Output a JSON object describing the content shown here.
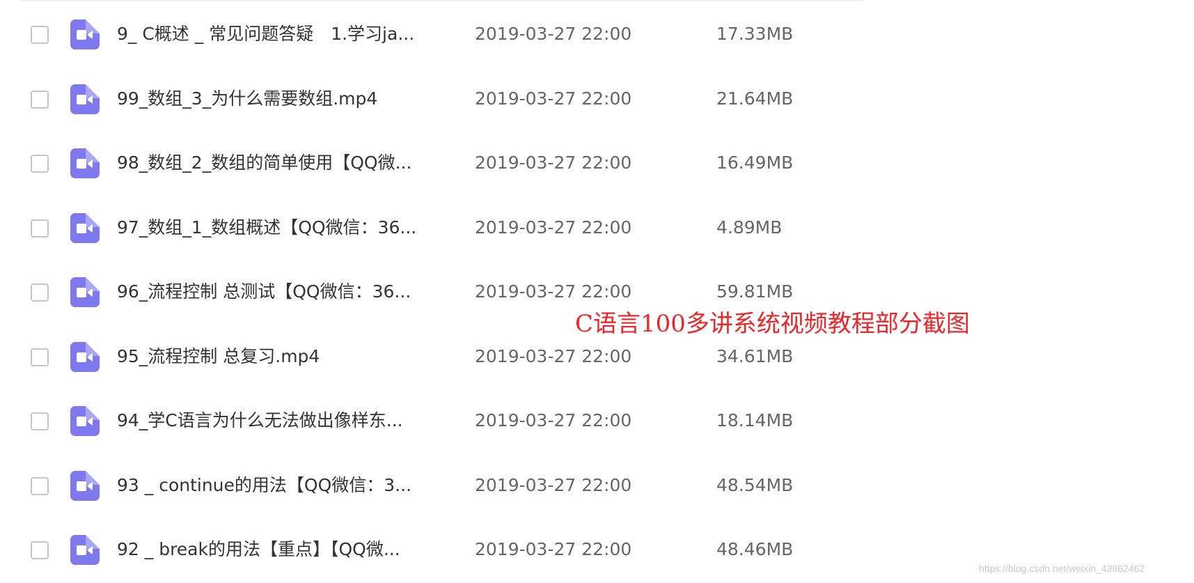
{
  "files": [
    {
      "name": "9_ C概述 _ 常见问题答疑　1.学习ja...",
      "date": "2019-03-27 22:00",
      "size": "17.33MB",
      "icon": "video-file-icon"
    },
    {
      "name": "99_数组_3_为什么需要数组.mp4",
      "date": "2019-03-27 22:00",
      "size": "21.64MB",
      "icon": "video-file-icon"
    },
    {
      "name": "98_数组_2_数组的简单使用【QQ微...",
      "date": "2019-03-27 22:00",
      "size": "16.49MB",
      "icon": "video-file-icon"
    },
    {
      "name": "97_数组_1_数组概述【QQ微信：36...",
      "date": "2019-03-27 22:00",
      "size": "4.89MB",
      "icon": "video-file-icon"
    },
    {
      "name": "96_流程控制 总测试【QQ微信：36...",
      "date": "2019-03-27 22:00",
      "size": "59.81MB",
      "icon": "video-file-icon"
    },
    {
      "name": "95_流程控制 总复习.mp4",
      "date": "2019-03-27 22:00",
      "size": "34.61MB",
      "icon": "video-file-icon"
    },
    {
      "name": "94_学C语言为什么无法做出像样东...",
      "date": "2019-03-27 22:00",
      "size": "18.14MB",
      "icon": "video-file-icon"
    },
    {
      "name": "93 _ continue的用法【QQ微信：3...",
      "date": "2019-03-27 22:00",
      "size": "48.54MB",
      "icon": "video-file-icon"
    },
    {
      "name": "92 _ break的用法【重点】【QQ微...",
      "date": "2019-03-27 22:00",
      "size": "48.46MB",
      "icon": "video-file-icon"
    }
  ],
  "overlay": {
    "caption": "C语言100多讲系统视频教程部分截图",
    "caption_color": "#e8272b"
  },
  "watermark": "https://blog.csdn.net/weixin_43862462",
  "colors": {
    "icon_bg": "#7f79f0",
    "text": "#333333",
    "meta_text": "#666666",
    "checkbox_border": "#c6c6c6"
  }
}
